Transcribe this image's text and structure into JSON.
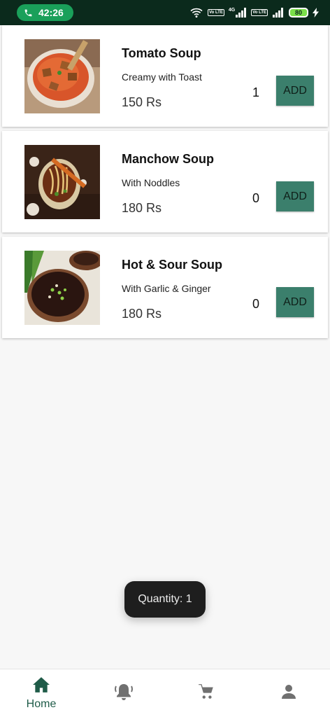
{
  "status_bar": {
    "time": "42:26",
    "call_icon": "phone-icon",
    "battery": "80",
    "icons": [
      "wifi-icon",
      "volte-icon",
      "signal-4g-icon",
      "volte-icon",
      "signal-icon",
      "battery-icon",
      "charging-icon"
    ],
    "volte_label": "Vo LTE",
    "network_label": "4G"
  },
  "items": [
    {
      "title": "Tomato Soup",
      "description": "Creamy with Toast",
      "price": "150 Rs",
      "quantity": "1",
      "add_label": "ADD"
    },
    {
      "title": "Manchow Soup",
      "description": "With Noddles",
      "price": "180 Rs",
      "quantity": "0",
      "add_label": "ADD"
    },
    {
      "title": "Hot & Sour Soup",
      "description": "With Garlic & Ginger",
      "price": "180 Rs",
      "quantity": "0",
      "add_label": "ADD"
    }
  ],
  "toast": {
    "text": "Quantity: 1"
  },
  "bottom_nav": {
    "items": [
      {
        "label": "Home",
        "icon": "home-icon",
        "active": true
      },
      {
        "label": "",
        "icon": "bell-icon",
        "active": false
      },
      {
        "label": "",
        "icon": "cart-icon",
        "active": false
      },
      {
        "label": "",
        "icon": "profile-icon",
        "active": false
      }
    ]
  },
  "colors": {
    "status_bar_bg": "#0b2a1c",
    "call_pill": "#1aa05a",
    "add_button": "#3b7f6c",
    "nav_active": "#1f5b48",
    "toast_bg": "#1e1e1e"
  }
}
